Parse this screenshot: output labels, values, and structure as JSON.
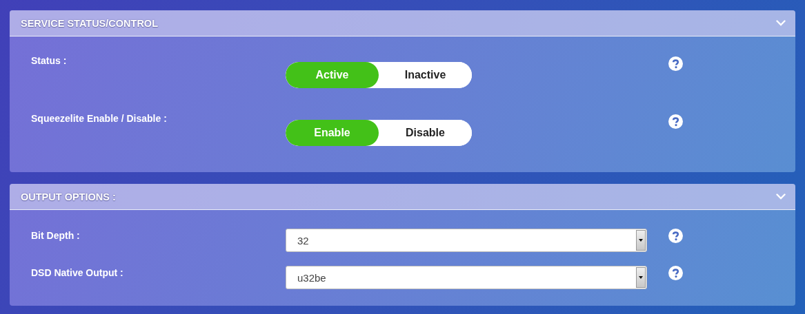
{
  "panels": [
    {
      "title": "SERVICE STATUS/CONTROL",
      "rows": [
        {
          "kind": "toggle",
          "label": "Status :",
          "options": [
            {
              "label": "Active",
              "selected": true
            },
            {
              "label": "Inactive",
              "selected": false
            }
          ]
        },
        {
          "kind": "toggle",
          "label": "Squeezelite Enable / Disable :",
          "options": [
            {
              "label": "Enable",
              "selected": true
            },
            {
              "label": "Disable",
              "selected": false
            }
          ]
        }
      ]
    },
    {
      "title": "OUTPUT OPTIONS :",
      "rows": [
        {
          "kind": "select",
          "label": "Bit Depth :",
          "value": "32"
        },
        {
          "kind": "select",
          "label": "DSD Native Output :",
          "value": "u32be"
        }
      ]
    }
  ]
}
